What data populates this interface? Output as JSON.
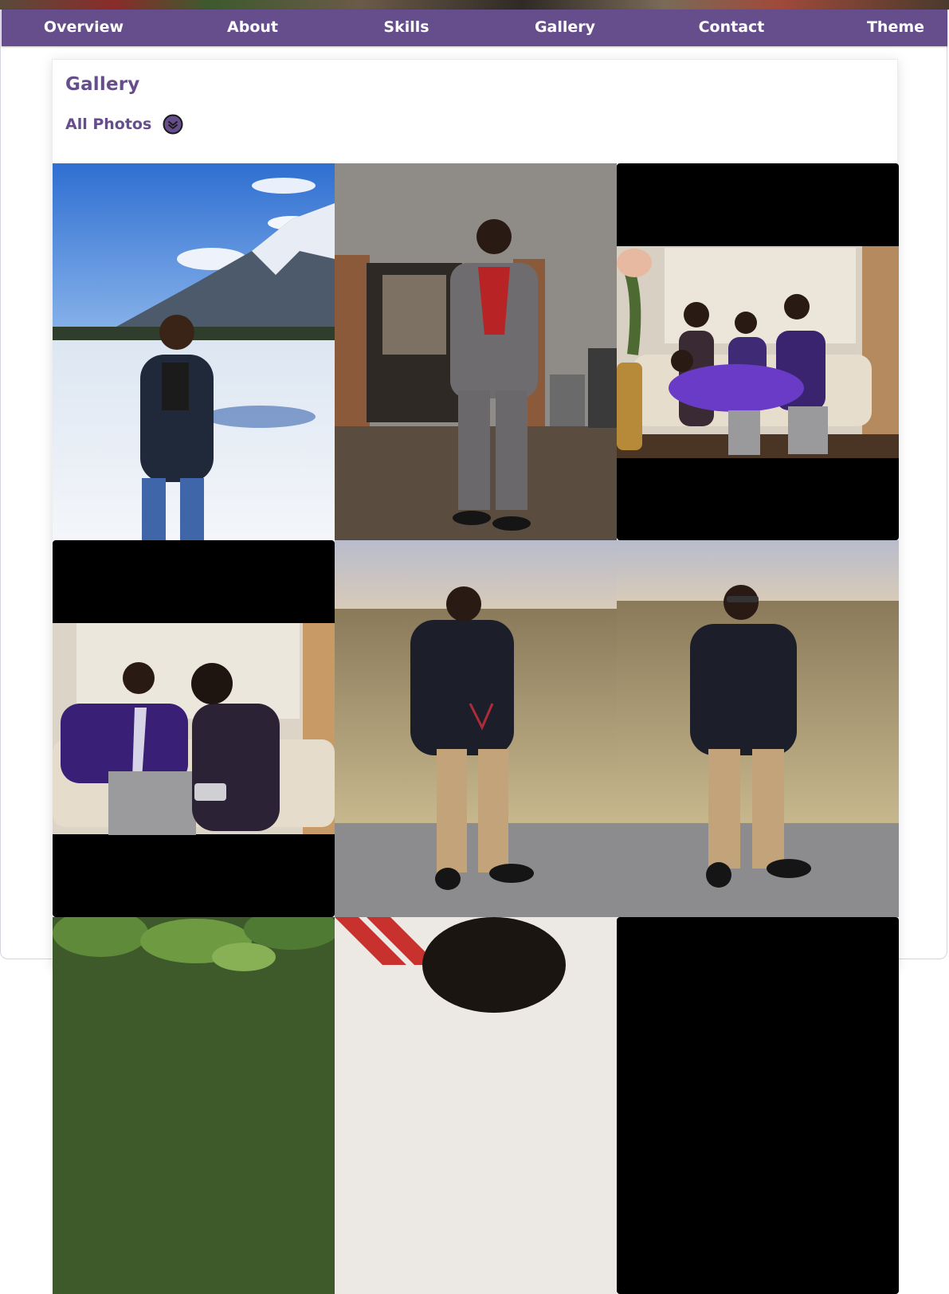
{
  "nav": {
    "items": [
      {
        "label": "Overview"
      },
      {
        "label": "About"
      },
      {
        "label": "Skills"
      },
      {
        "label": "Gallery"
      },
      {
        "label": "Contact"
      },
      {
        "label": "Theme"
      }
    ]
  },
  "gallery": {
    "title": "Gallery",
    "filter_label": "All Photos",
    "filter_icon": "chevron-down-circle-icon",
    "photos": [
      {
        "name": "photo-mountain-snow"
      },
      {
        "name": "photo-suit-red-shirt"
      },
      {
        "name": "photo-family-couch"
      },
      {
        "name": "photo-couple-couch"
      },
      {
        "name": "photo-field-holding-glasses"
      },
      {
        "name": "photo-field-sunglasses"
      },
      {
        "name": "photo-plant-leaves"
      },
      {
        "name": "photo-portrait-red-stripes"
      },
      {
        "name": "photo-letterboxed"
      }
    ]
  },
  "colors": {
    "brand_purple": "#664e8d",
    "nav_text": "#ffffff",
    "page_bg": "#ffffff"
  }
}
